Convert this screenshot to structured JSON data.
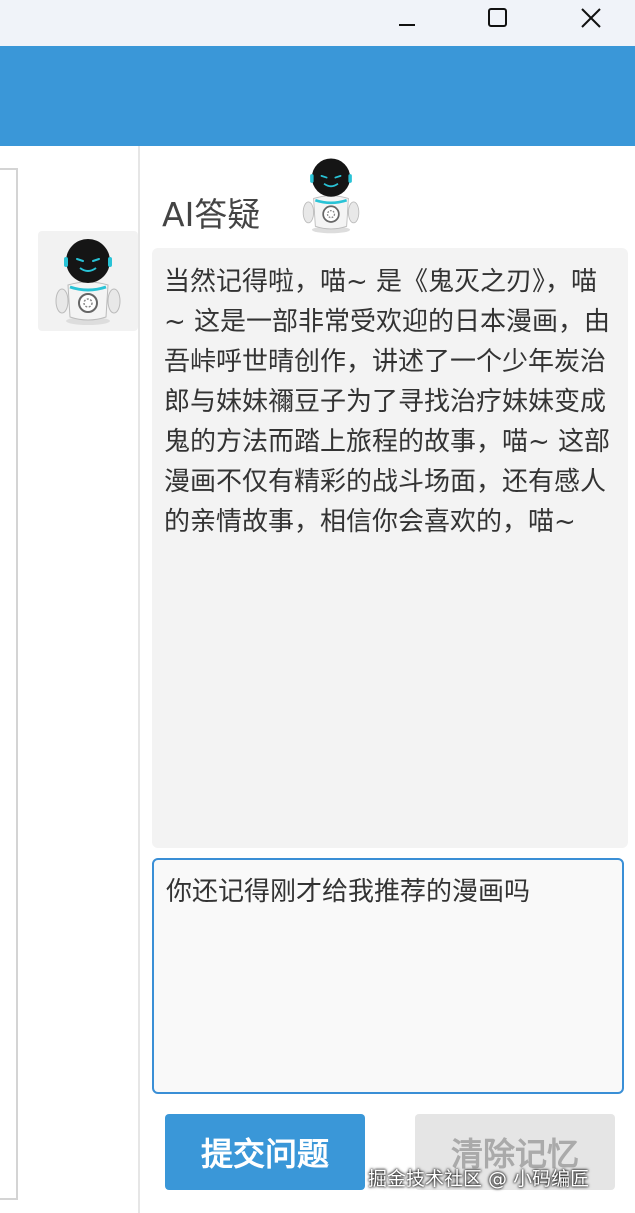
{
  "window_controls": {
    "minimize_icon": "minimize-icon",
    "maximize_icon": "maximize-icon",
    "close_icon": "close-icon"
  },
  "chat": {
    "title": "AI答疑",
    "answer": "当然记得啦，喵~ 是《鬼灭之刃》，喵~ 这是一部非常受欢迎的日本漫画，由吾峠呼世晴创作，讲述了一个少年炭治郎与妹妹禰豆子为了寻找治疗妹妹变成鬼的方法而踏上旅程的故事，喵~ 这部漫画不仅有精彩的战斗场面，还有感人的亲情故事，相信你会喜欢的，喵~",
    "question_value": "你还记得刚才给我推荐的漫画吗",
    "submit_label": "提交问题",
    "clear_label": "清除记忆"
  },
  "watermark": "掘金技术社区 @ 小码编匠",
  "colors": {
    "accent": "#3a97d8",
    "answer_bg": "#f3f3f3",
    "input_border": "#3a8fd6",
    "disabled_bg": "#e5e5e5"
  }
}
